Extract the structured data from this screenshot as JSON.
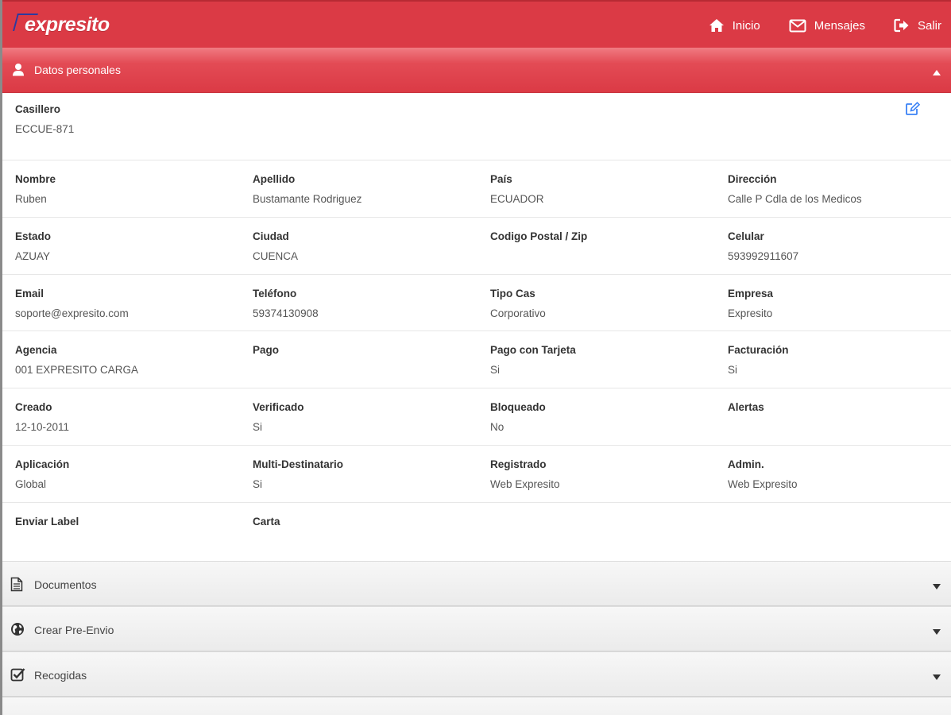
{
  "app": {
    "logo_text": "expresito"
  },
  "nav": {
    "home": "Inicio",
    "messages": "Mensajes",
    "logout": "Salir"
  },
  "personal_section": {
    "title": "Datos personales"
  },
  "casillero": {
    "label": "Casillero",
    "value": "ECCUE-871"
  },
  "rows": [
    [
      {
        "label": "Nombre",
        "value": "Ruben"
      },
      {
        "label": "Apellido",
        "value": "Bustamante Rodriguez"
      },
      {
        "label": "País",
        "value": "ECUADOR"
      },
      {
        "label": "Dirección",
        "value": "Calle P Cdla de los Medicos"
      }
    ],
    [
      {
        "label": "Estado",
        "value": "AZUAY"
      },
      {
        "label": "Ciudad",
        "value": "CUENCA"
      },
      {
        "label": "Codigo Postal / Zip",
        "value": ""
      },
      {
        "label": "Celular",
        "value": "593992911607"
      }
    ],
    [
      {
        "label": "Email",
        "value": "soporte@expresito.com"
      },
      {
        "label": "Teléfono",
        "value": "59374130908"
      },
      {
        "label": "Tipo Cas",
        "value": "Corporativo"
      },
      {
        "label": "Empresa",
        "value": "Expresito"
      }
    ],
    [
      {
        "label": "Agencia",
        "value": "001 EXPRESITO CARGA"
      },
      {
        "label": "Pago",
        "value": ""
      },
      {
        "label": "Pago con Tarjeta",
        "value": "Si"
      },
      {
        "label": "Facturación",
        "value": "Si"
      }
    ],
    [
      {
        "label": "Creado",
        "value": "12-10-2011"
      },
      {
        "label": "Verificado",
        "value": "Si"
      },
      {
        "label": "Bloqueado",
        "value": "No"
      },
      {
        "label": "Alertas",
        "value": ""
      }
    ],
    [
      {
        "label": "Aplicación",
        "value": "Global"
      },
      {
        "label": "Multi-Destinatario",
        "value": "Si"
      },
      {
        "label": "Registrado",
        "value": "Web Expresito"
      },
      {
        "label": "Admin.",
        "value": "Web Expresito"
      }
    ],
    [
      {
        "label": "Enviar Label",
        "value": ""
      },
      {
        "label": "Carta",
        "value": ""
      }
    ]
  ],
  "sections": [
    {
      "label": "Documentos",
      "icon": "document-icon"
    },
    {
      "label": "Crear Pre-Envio",
      "icon": "globe-icon"
    },
    {
      "label": "Recogidas",
      "icon": "checkbox-icon"
    }
  ],
  "colors": {
    "brand_red": "#db3a45",
    "brand_blue": "#2c3aa0",
    "edit_blue": "#3b82f6"
  }
}
